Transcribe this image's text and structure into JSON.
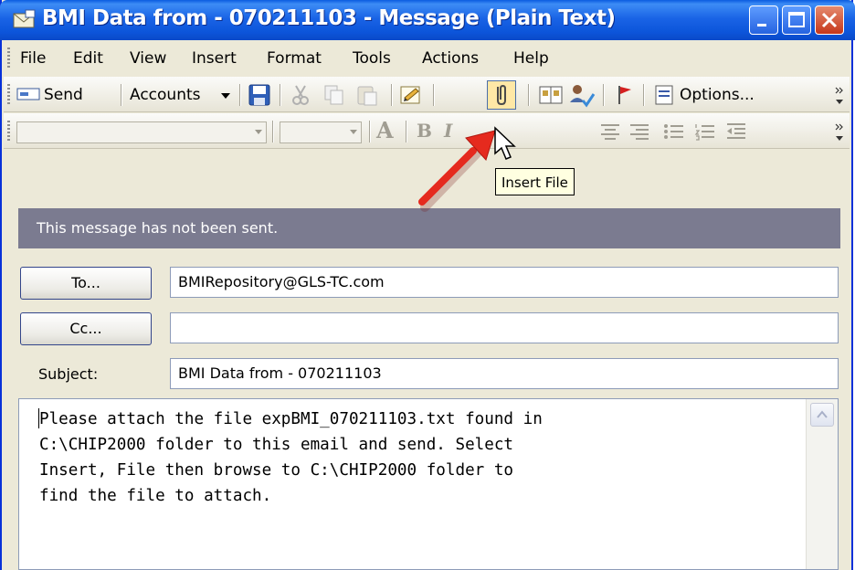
{
  "window": {
    "title": "BMI Data from - 070211103 - Message (Plain Text)",
    "colors": {
      "titlebar": "#0a5ce0",
      "close_button": "#c6371a",
      "infobar": "#7b7b90",
      "tooltip_bg": "#ffffe1"
    }
  },
  "menu": {
    "items": [
      {
        "label": "File"
      },
      {
        "label": "Edit"
      },
      {
        "label": "View"
      },
      {
        "label": "Insert"
      },
      {
        "label": "Format"
      },
      {
        "label": "Tools"
      },
      {
        "label": "Actions"
      },
      {
        "label": "Help"
      }
    ]
  },
  "toolbar": {
    "send_label": "Send",
    "accounts_label": "Accounts",
    "options_label": "Options...",
    "icons": [
      "send-icon",
      "save-icon",
      "cut-icon",
      "copy-icon",
      "paste-icon",
      "signature-icon",
      "paperclip-icon",
      "address-book-icon",
      "check-names-icon",
      "flag-icon",
      "options-icon"
    ]
  },
  "format_toolbar": {
    "font_value": "",
    "size_value": "",
    "icons": [
      "font-color-icon",
      "bold-icon",
      "italic-icon",
      "align-center-icon",
      "align-right-icon",
      "bullets-icon",
      "numbering-icon",
      "decrease-indent-icon"
    ]
  },
  "tooltip": {
    "text": "Insert File"
  },
  "infobar": {
    "text": "This message has not been sent."
  },
  "fields": {
    "to_label": "To...",
    "to_value": "BMIRepository@GLS-TC.com",
    "cc_label": "Cc...",
    "cc_value": "",
    "subject_label": "Subject:",
    "subject_value": "BMI Data from - 070211103"
  },
  "body": {
    "lines": [
      "Please attach the file expBMI_070211103.txt found in",
      "C:\\CHIP2000 folder to this email and send. Select",
      "Insert, File then browse to C:\\CHIP2000 folder to",
      "find the file to attach."
    ]
  }
}
